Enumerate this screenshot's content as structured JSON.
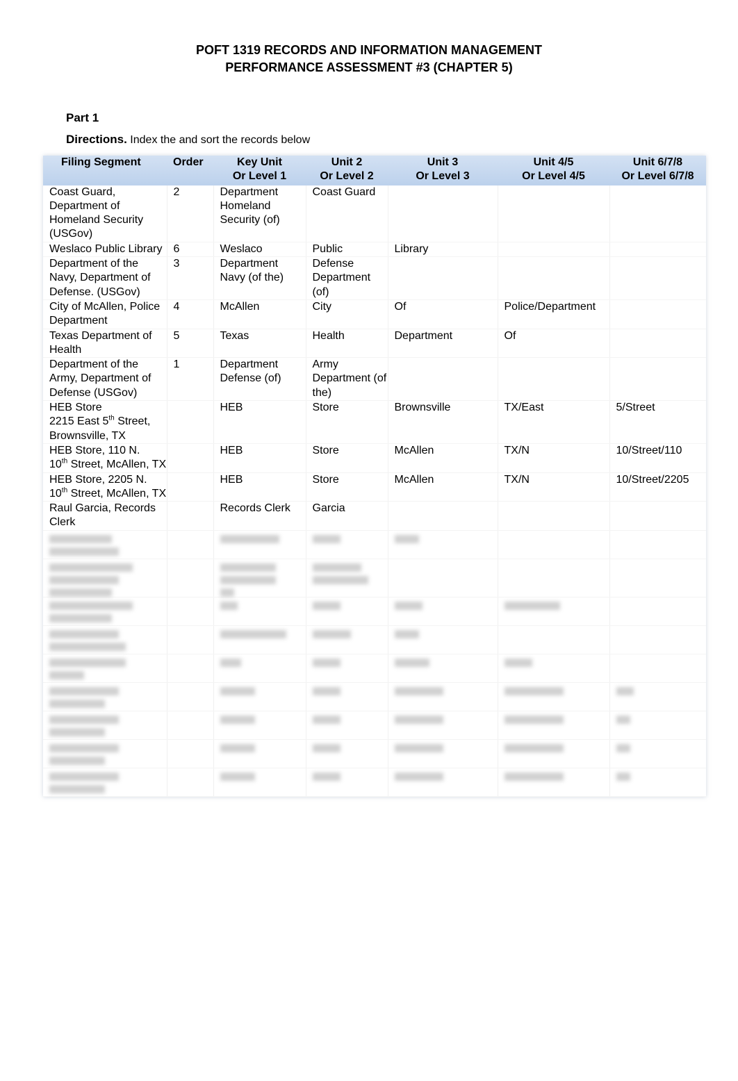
{
  "title": {
    "line1": "POFT 1319 RECORDS AND INFORMATION MANAGEMENT",
    "line2": "PERFORMANCE ASSESSMENT #3 (CHAPTER 5)"
  },
  "part": "Part 1",
  "directions": {
    "label": "Directions.",
    "text": " Index the and sort the records below"
  },
  "table": {
    "headers": [
      [
        "Filing Segment",
        ""
      ],
      [
        "Order",
        ""
      ],
      [
        "Key Unit",
        "Or Level 1"
      ],
      [
        "Unit 2",
        "Or Level 2"
      ],
      [
        "Unit 3",
        "Or Level 3"
      ],
      [
        "Unit 4/5",
        "Or Level 4/5"
      ],
      [
        "Unit 6/7/8",
        "Or Level 6/7/8"
      ]
    ],
    "rows": [
      [
        "Coast Guard, Department of Homeland Security (USGov)",
        "2",
        "Department Homeland Security (of)",
        "Coast Guard",
        "",
        "",
        ""
      ],
      [
        "Weslaco Public Library",
        "6",
        "Weslaco",
        "Public",
        "Library",
        "",
        ""
      ],
      [
        "Department of the Navy, Department of Defense. (USGov)",
        "3",
        "Department Navy (of the)",
        "Defense Department (of)",
        "",
        "",
        ""
      ],
      [
        "City of McAllen, Police Department",
        "4",
        "McAllen",
        "City",
        "Of",
        "Police/Department",
        ""
      ],
      [
        "Texas Department of Health",
        "5",
        "Texas",
        "Health",
        "Department",
        "Of",
        ""
      ],
      [
        "Department of the Army, Department of Defense (USGov)",
        "1",
        "Department Defense (of)",
        "Army Department (of the)",
        "",
        "",
        ""
      ],
      [
        "HEB Store",
        "",
        "HEB",
        "Store",
        "Brownsville",
        "TX/East",
        "5/Street"
      ],
      [
        "HEB Store, 110 N.",
        "",
        "HEB",
        "Store",
        "McAllen",
        "TX/N",
        "10/Street/110"
      ],
      [
        "HEB Store, 2205 N.",
        "",
        "HEB",
        "Store",
        "McAllen",
        "TX/N",
        "10/Street/2205"
      ],
      [
        "Raul Garcia, Records Clerk",
        "",
        "Records Clerk",
        "Garcia",
        "",
        "",
        ""
      ]
    ],
    "heb1_address": [
      "2215 East 5",
      "th",
      " Street, Brownsville, TX"
    ],
    "heb_n_address": [
      "10",
      "th",
      " Street, McAllen, TX"
    ]
  }
}
